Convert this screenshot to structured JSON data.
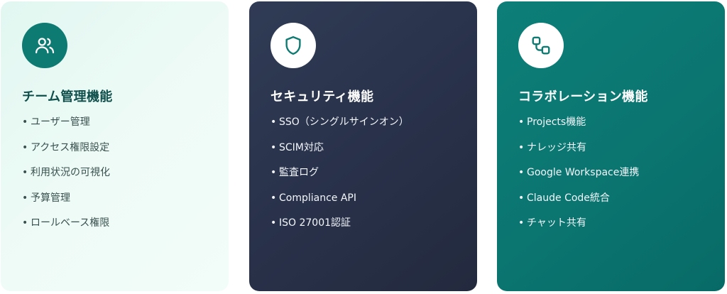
{
  "cards": [
    {
      "icon": "users-icon",
      "title": "チーム管理機能",
      "items": [
        "ユーザー管理",
        "アクセス権限設定",
        "利用状況の可視化",
        "予算管理",
        "ロールベース権限"
      ]
    },
    {
      "icon": "shield-icon",
      "title": "セキュリティ機能",
      "items": [
        "SSO（シングルサインオン）",
        "SCIM対応",
        "監査ログ",
        "Compliance API",
        "ISO 27001認証"
      ]
    },
    {
      "icon": "connected-squares-icon",
      "title": "コラボレーション機能",
      "items": [
        "Projects機能",
        "ナレッジ共有",
        "Google Workspace連携",
        "Claude Code統合",
        "チャット共有"
      ]
    }
  ],
  "bullet": "•",
  "colors": {
    "team_icon_bg": "#0e7b72",
    "security_card_bg": "#2b3450",
    "collab_card_bg": "#0b7570",
    "team_card_bg": "#e8f9f3",
    "team_title": "#0f4f4b"
  }
}
